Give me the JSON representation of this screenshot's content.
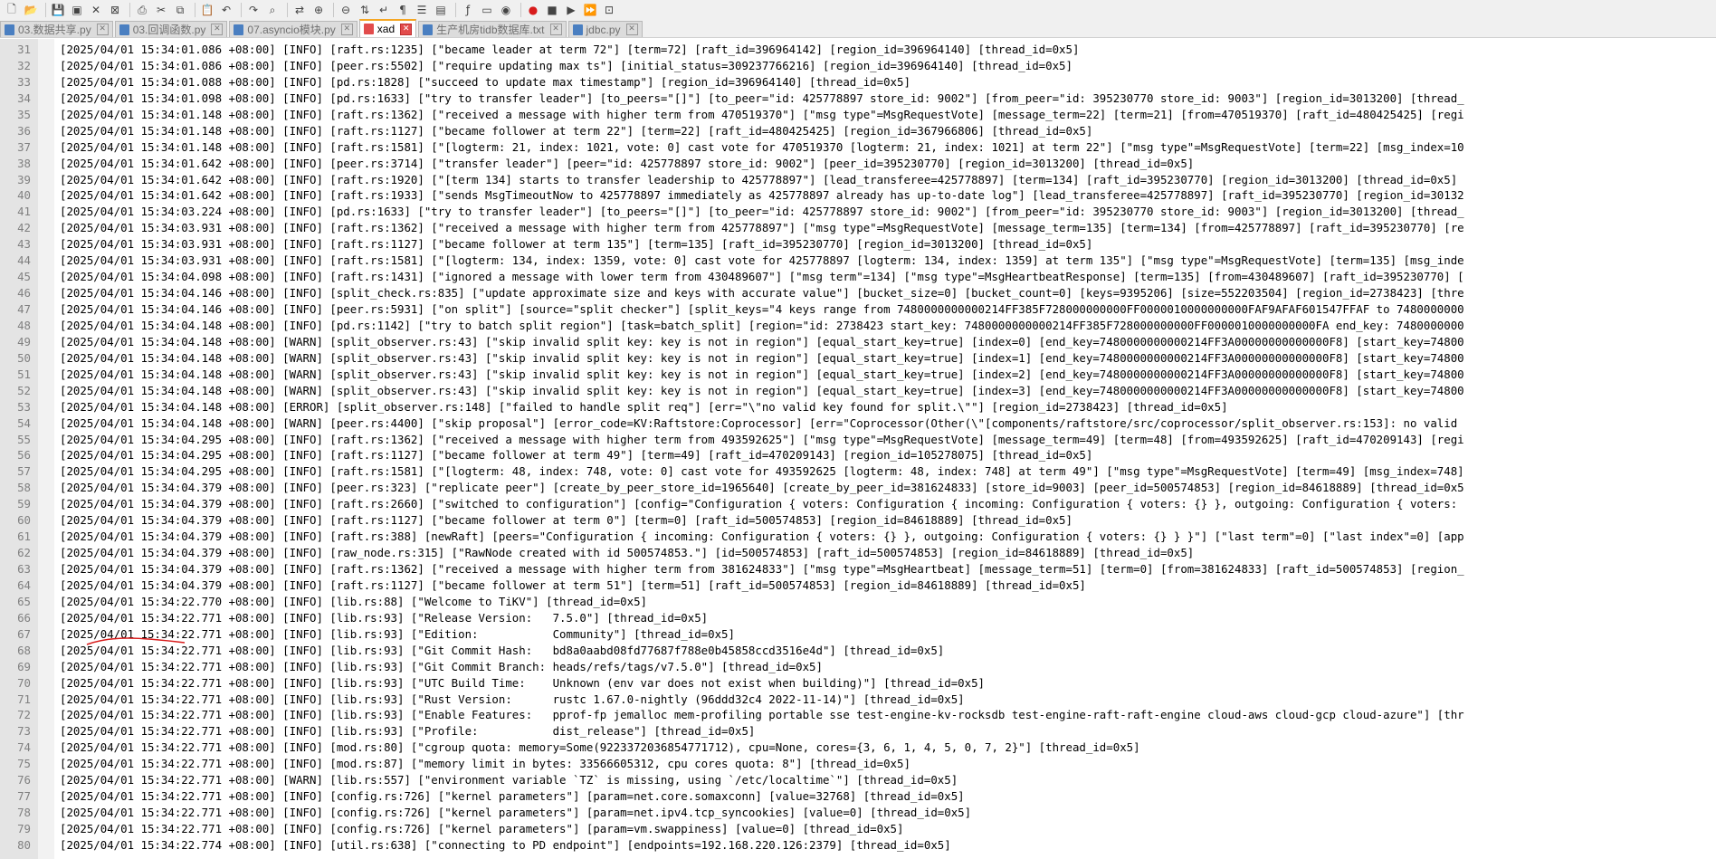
{
  "toolbar": {
    "buttons": [
      "new-file-icon",
      "open-file-icon",
      "save-icon",
      "save-all-icon",
      "close-icon",
      "close-all-icon",
      "print-icon",
      "cut-icon",
      "copy-icon",
      "paste-icon",
      "undo-icon",
      "redo-icon",
      "find-icon",
      "replace-icon",
      "zoom-in-icon",
      "zoom-out-icon",
      "sync-scroll-icon",
      "wrap-icon",
      "show-all-chars-icon",
      "indent-guide-icon",
      "doc-map-icon",
      "function-list-icon",
      "folder-workspace-icon",
      "monitor-icon",
      "record-macro-icon",
      "stop-macro-icon",
      "play-macro-icon",
      "run-macro-icon",
      "save-macro-icon"
    ]
  },
  "tabs": [
    {
      "label": "03.数据共享.py",
      "icon_color": "#4a7fc1",
      "active": false
    },
    {
      "label": "03.回调函数.py",
      "icon_color": "#4a7fc1",
      "active": false
    },
    {
      "label": "07.asyncio模块.py",
      "icon_color": "#4a7fc1",
      "active": false
    },
    {
      "label": "xad",
      "icon_color": "#e24c4c",
      "active": true
    },
    {
      "label": "生产机房tidb数据库.txt",
      "icon_color": "#4a7fc1",
      "active": false
    },
    {
      "label": "jdbc.py",
      "icon_color": "#4a7fc1",
      "active": false
    }
  ],
  "editor": {
    "lines": [
      {
        "n": "31",
        "t": "[2025/04/01 15:34:01.086 +08:00] [INFO] [raft.rs:1235] [\"became leader at term 72\"] [term=72] [raft_id=396964142] [region_id=396964140] [thread_id=0x5]"
      },
      {
        "n": "32",
        "t": "[2025/04/01 15:34:01.086 +08:00] [INFO] [peer.rs:5502] [\"require updating max ts\"] [initial_status=309237766216] [region_id=396964140] [thread_id=0x5]"
      },
      {
        "n": "33",
        "t": "[2025/04/01 15:34:01.088 +08:00] [INFO] [pd.rs:1828] [\"succeed to update max timestamp\"] [region_id=396964140] [thread_id=0x5]"
      },
      {
        "n": "34",
        "t": "[2025/04/01 15:34:01.098 +08:00] [INFO] [pd.rs:1633] [\"try to transfer leader\"] [to_peers=\"[]\"] [to_peer=\"id: 425778897 store_id: 9002\"] [from_peer=\"id: 395230770 store_id: 9003\"] [region_id=3013200] [thread_"
      },
      {
        "n": "35",
        "t": "[2025/04/01 15:34:01.148 +08:00] [INFO] [raft.rs:1362] [\"received a message with higher term from 470519370\"] [\"msg type\"=MsgRequestVote] [message_term=22] [term=21] [from=470519370] [raft_id=480425425] [regi"
      },
      {
        "n": "36",
        "t": "[2025/04/01 15:34:01.148 +08:00] [INFO] [raft.rs:1127] [\"became follower at term 22\"] [term=22] [raft_id=480425425] [region_id=367966806] [thread_id=0x5]"
      },
      {
        "n": "37",
        "t": "[2025/04/01 15:34:01.148 +08:00] [INFO] [raft.rs:1581] [\"[logterm: 21, index: 1021, vote: 0] cast vote for 470519370 [logterm: 21, index: 1021] at term 22\"] [\"msg type\"=MsgRequestVote] [term=22] [msg_index=10"
      },
      {
        "n": "38",
        "t": "[2025/04/01 15:34:01.642 +08:00] [INFO] [peer.rs:3714] [\"transfer leader\"] [peer=\"id: 425778897 store_id: 9002\"] [peer_id=395230770] [region_id=3013200] [thread_id=0x5]"
      },
      {
        "n": "39",
        "t": "[2025/04/01 15:34:01.642 +08:00] [INFO] [raft.rs:1920] [\"[term 134] starts to transfer leadership to 425778897\"] [lead_transferee=425778897] [term=134] [raft_id=395230770] [region_id=3013200] [thread_id=0x5]"
      },
      {
        "n": "40",
        "t": "[2025/04/01 15:34:01.642 +08:00] [INFO] [raft.rs:1933] [\"sends MsgTimeoutNow to 425778897 immediately as 425778897 already has up-to-date log\"] [lead_transferee=425778897] [raft_id=395230770] [region_id=30132"
      },
      {
        "n": "41",
        "t": "[2025/04/01 15:34:03.224 +08:00] [INFO] [pd.rs:1633] [\"try to transfer leader\"] [to_peers=\"[]\"] [to_peer=\"id: 425778897 store_id: 9002\"] [from_peer=\"id: 395230770 store_id: 9003\"] [region_id=3013200] [thread_"
      },
      {
        "n": "42",
        "t": "[2025/04/01 15:34:03.931 +08:00] [INFO] [raft.rs:1362] [\"received a message with higher term from 425778897\"] [\"msg type\"=MsgRequestVote] [message_term=135] [term=134] [from=425778897] [raft_id=395230770] [re"
      },
      {
        "n": "43",
        "t": "[2025/04/01 15:34:03.931 +08:00] [INFO] [raft.rs:1127] [\"became follower at term 135\"] [term=135] [raft_id=395230770] [region_id=3013200] [thread_id=0x5]"
      },
      {
        "n": "44",
        "t": "[2025/04/01 15:34:03.931 +08:00] [INFO] [raft.rs:1581] [\"[logterm: 134, index: 1359, vote: 0] cast vote for 425778897 [logterm: 134, index: 1359] at term 135\"] [\"msg type\"=MsgRequestVote] [term=135] [msg_inde"
      },
      {
        "n": "45",
        "t": "[2025/04/01 15:34:04.098 +08:00] [INFO] [raft.rs:1431] [\"ignored a message with lower term from 430489607\"] [\"msg term\"=134] [\"msg type\"=MsgHeartbeatResponse] [term=135] [from=430489607] [raft_id=395230770] ["
      },
      {
        "n": "46",
        "t": "[2025/04/01 15:34:04.146 +08:00] [INFO] [split_check.rs:835] [\"update approximate size and keys with accurate value\"] [bucket_size=0] [bucket_count=0] [keys=9395206] [size=552203504] [region_id=2738423] [thre"
      },
      {
        "n": "47",
        "t": "[2025/04/01 15:34:04.146 +08:00] [INFO] [peer.rs:5931] [\"on split\"] [source=\"split checker\"] [split_keys=\"4 keys range from 7480000000000214FF385F728000000000FF0000010000000000FAF9AFAF601547FFAF to 7480000000"
      },
      {
        "n": "48",
        "t": "[2025/04/01 15:34:04.148 +08:00] [INFO] [pd.rs:1142] [\"try to batch split region\"] [task=batch_split] [region=\"id: 2738423 start_key: 7480000000000214FF385F728000000000FF0000010000000000FA end_key: 7480000000"
      },
      {
        "n": "49",
        "t": "[2025/04/01 15:34:04.148 +08:00] [WARN] [split_observer.rs:43] [\"skip invalid split key: key is not in region\"] [equal_start_key=true] [index=0] [end_key=7480000000000214FF3A00000000000000F8] [start_key=74800"
      },
      {
        "n": "50",
        "t": "[2025/04/01 15:34:04.148 +08:00] [WARN] [split_observer.rs:43] [\"skip invalid split key: key is not in region\"] [equal_start_key=true] [index=1] [end_key=7480000000000214FF3A00000000000000F8] [start_key=74800"
      },
      {
        "n": "51",
        "t": "[2025/04/01 15:34:04.148 +08:00] [WARN] [split_observer.rs:43] [\"skip invalid split key: key is not in region\"] [equal_start_key=true] [index=2] [end_key=7480000000000214FF3A00000000000000F8] [start_key=74800"
      },
      {
        "n": "52",
        "t": "[2025/04/01 15:34:04.148 +08:00] [WARN] [split_observer.rs:43] [\"skip invalid split key: key is not in region\"] [equal_start_key=true] [index=3] [end_key=7480000000000214FF3A00000000000000F8] [start_key=74800"
      },
      {
        "n": "53",
        "t": "[2025/04/01 15:34:04.148 +08:00] [ERROR] [split_observer.rs:148] [\"failed to handle split req\"] [err=\"\\\"no valid key found for split.\\\"\"] [region_id=2738423] [thread_id=0x5]"
      },
      {
        "n": "54",
        "t": "[2025/04/01 15:34:04.148 +08:00] [WARN] [peer.rs:4400] [\"skip proposal\"] [error_code=KV:Raftstore:Coprocessor] [err=\"Coprocessor(Other(\\\"[components/raftstore/src/coprocessor/split_observer.rs:153]: no valid"
      },
      {
        "n": "55",
        "t": "[2025/04/01 15:34:04.295 +08:00] [INFO] [raft.rs:1362] [\"received a message with higher term from 493592625\"] [\"msg type\"=MsgRequestVote] [message_term=49] [term=48] [from=493592625] [raft_id=470209143] [regi"
      },
      {
        "n": "56",
        "t": "[2025/04/01 15:34:04.295 +08:00] [INFO] [raft.rs:1127] [\"became follower at term 49\"] [term=49] [raft_id=470209143] [region_id=105278075] [thread_id=0x5]"
      },
      {
        "n": "57",
        "t": "[2025/04/01 15:34:04.295 +08:00] [INFO] [raft.rs:1581] [\"[logterm: 48, index: 748, vote: 0] cast vote for 493592625 [logterm: 48, index: 748] at term 49\"] [\"msg type\"=MsgRequestVote] [term=49] [msg_index=748]"
      },
      {
        "n": "58",
        "t": "[2025/04/01 15:34:04.379 +08:00] [INFO] [peer.rs:323] [\"replicate peer\"] [create_by_peer_store_id=1965640] [create_by_peer_id=381624833] [store_id=9003] [peer_id=500574853] [region_id=84618889] [thread_id=0x5"
      },
      {
        "n": "59",
        "t": "[2025/04/01 15:34:04.379 +08:00] [INFO] [raft.rs:2660] [\"switched to configuration\"] [config=\"Configuration { voters: Configuration { incoming: Configuration { voters: {} }, outgoing: Configuration { voters:"
      },
      {
        "n": "60",
        "t": "[2025/04/01 15:34:04.379 +08:00] [INFO] [raft.rs:1127] [\"became follower at term 0\"] [term=0] [raft_id=500574853] [region_id=84618889] [thread_id=0x5]"
      },
      {
        "n": "61",
        "t": "[2025/04/01 15:34:04.379 +08:00] [INFO] [raft.rs:388] [newRaft] [peers=\"Configuration { incoming: Configuration { voters: {} }, outgoing: Configuration { voters: {} } }\"] [\"last term\"=0] [\"last index\"=0] [app"
      },
      {
        "n": "62",
        "t": "[2025/04/01 15:34:04.379 +08:00] [INFO] [raw_node.rs:315] [\"RawNode created with id 500574853.\"] [id=500574853] [raft_id=500574853] [region_id=84618889] [thread_id=0x5]"
      },
      {
        "n": "63",
        "t": "[2025/04/01 15:34:04.379 +08:00] [INFO] [raft.rs:1362] [\"received a message with higher term from 381624833\"] [\"msg type\"=MsgHeartbeat] [message_term=51] [term=0] [from=381624833] [raft_id=500574853] [region_"
      },
      {
        "n": "64",
        "t": "[2025/04/01 15:34:04.379 +08:00] [INFO] [raft.rs:1127] [\"became follower at term 51\"] [term=51] [raft_id=500574853] [region_id=84618889] [thread_id=0x5]"
      },
      {
        "n": "65",
        "t": "[2025/04/01 15:34:22.770 +08:00] [INFO] [lib.rs:88] [\"Welcome to TiKV\"] [thread_id=0x5]"
      },
      {
        "n": "66",
        "t": "[2025/04/01 15:34:22.771 +08:00] [INFO] [lib.rs:93] [\"Release Version:   7.5.0\"] [thread_id=0x5]"
      },
      {
        "n": "67",
        "t": "[2025/04/01 15:34:22.771 +08:00] [INFO] [lib.rs:93] [\"Edition:           Community\"] [thread_id=0x5]"
      },
      {
        "n": "68",
        "t": "[2025/04/01 15:34:22.771 +08:00] [INFO] [lib.rs:93] [\"Git Commit Hash:   bd8a0aabd08fd77687f788e0b45858ccd3516e4d\"] [thread_id=0x5]"
      },
      {
        "n": "69",
        "t": "[2025/04/01 15:34:22.771 +08:00] [INFO] [lib.rs:93] [\"Git Commit Branch: heads/refs/tags/v7.5.0\"] [thread_id=0x5]"
      },
      {
        "n": "70",
        "t": "[2025/04/01 15:34:22.771 +08:00] [INFO] [lib.rs:93] [\"UTC Build Time:    Unknown (env var does not exist when building)\"] [thread_id=0x5]"
      },
      {
        "n": "71",
        "t": "[2025/04/01 15:34:22.771 +08:00] [INFO] [lib.rs:93] [\"Rust Version:      rustc 1.67.0-nightly (96ddd32c4 2022-11-14)\"] [thread_id=0x5]"
      },
      {
        "n": "72",
        "t": "[2025/04/01 15:34:22.771 +08:00] [INFO] [lib.rs:93] [\"Enable Features:   pprof-fp jemalloc mem-profiling portable sse test-engine-kv-rocksdb test-engine-raft-raft-engine cloud-aws cloud-gcp cloud-azure\"] [thr"
      },
      {
        "n": "73",
        "t": "[2025/04/01 15:34:22.771 +08:00] [INFO] [lib.rs:93] [\"Profile:           dist_release\"] [thread_id=0x5]"
      },
      {
        "n": "74",
        "t": "[2025/04/01 15:34:22.771 +08:00] [INFO] [mod.rs:80] [\"cgroup quota: memory=Some(9223372036854771712), cpu=None, cores={3, 6, 1, 4, 5, 0, 7, 2}\"] [thread_id=0x5]"
      },
      {
        "n": "75",
        "t": "[2025/04/01 15:34:22.771 +08:00] [INFO] [mod.rs:87] [\"memory limit in bytes: 33566605312, cpu cores quota: 8\"] [thread_id=0x5]"
      },
      {
        "n": "76",
        "t": "[2025/04/01 15:34:22.771 +08:00] [WARN] [lib.rs:557] [\"environment variable `TZ` is missing, using `/etc/localtime`\"] [thread_id=0x5]"
      },
      {
        "n": "77",
        "t": "[2025/04/01 15:34:22.771 +08:00] [INFO] [config.rs:726] [\"kernel parameters\"] [param=net.core.somaxconn] [value=32768] [thread_id=0x5]"
      },
      {
        "n": "78",
        "t": "[2025/04/01 15:34:22.771 +08:00] [INFO] [config.rs:726] [\"kernel parameters\"] [param=net.ipv4.tcp_syncookies] [value=0] [thread_id=0x5]"
      },
      {
        "n": "79",
        "t": "[2025/04/01 15:34:22.771 +08:00] [INFO] [config.rs:726] [\"kernel parameters\"] [param=vm.swappiness] [value=0] [thread_id=0x5]"
      },
      {
        "n": "80",
        "t": "[2025/04/01 15:34:22.774 +08:00] [INFO] [util.rs:638] [\"connecting to PD endpoint\"] [endpoints=192.168.220.126:2379] [thread_id=0x5]"
      }
    ]
  }
}
